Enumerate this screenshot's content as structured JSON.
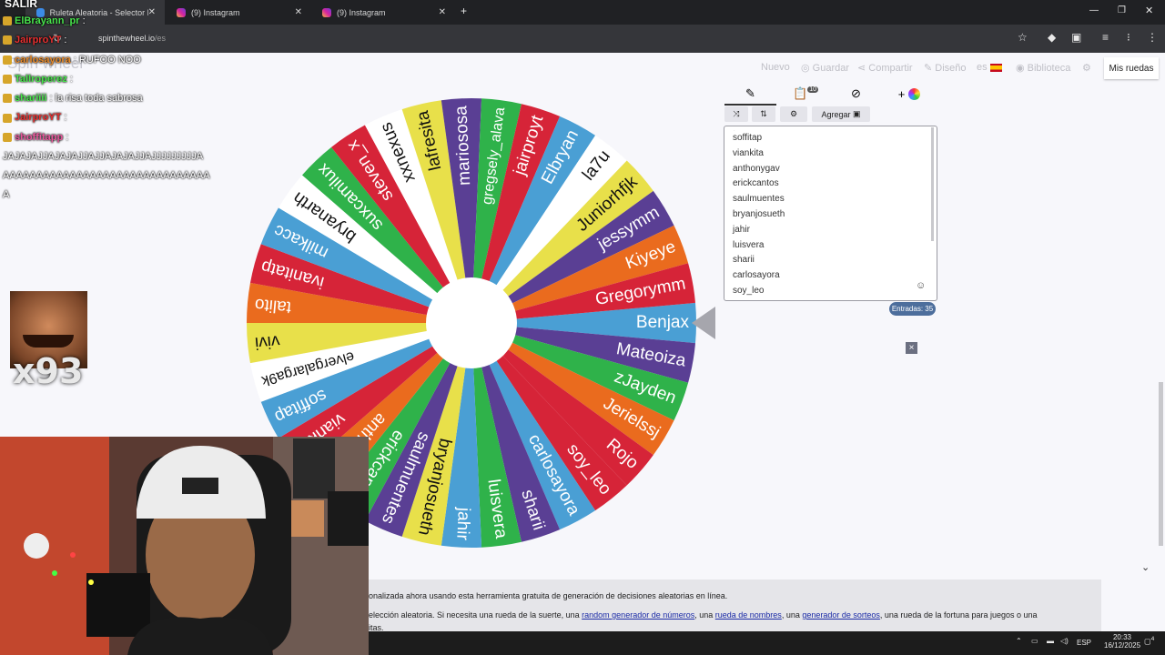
{
  "browser": {
    "tabs": [
      {
        "title": "Ruleta Aleatoria - Selector Pers",
        "active": true
      },
      {
        "title": "(9) Instagram",
        "active": false
      },
      {
        "title": "(9) Instagram",
        "active": false
      }
    ],
    "url_domain": "spinthewheel.io",
    "url_path": "/es",
    "new_tab": "+"
  },
  "stream": {
    "exit_label": "SALIR",
    "brand_faded": "Spin wheel",
    "counter": "x93",
    "chat": [
      {
        "user": "ElBrayann_pr",
        "message": ":",
        "color": "#48e44c"
      },
      {
        "user": "JairproYT",
        "message": ":",
        "color": "#e83030"
      },
      {
        "user": "carlosayora",
        "message": ": RUFOO NOO",
        "color": "#e88a2a"
      },
      {
        "user": "Tallroperez",
        "message": ":",
        "color": "#48e44c"
      },
      {
        "user": "shariiii",
        "message": ": la risa toda sabrosa",
        "color": "#48e44c"
      },
      {
        "user": "JairproYT",
        "message": ":",
        "color": "#e83030"
      },
      {
        "user": "shoffitapp",
        "message": ":",
        "color": "#e8579b"
      }
    ],
    "long_message": [
      "JAJAJAJJAJAJAJJAJJAJAJAJJAJJJJJJJJJA",
      "AAAAAAAAAAAAAAAAAAAAAAAAAAAAAAA",
      "A"
    ]
  },
  "menu": {
    "nuevo": "Nuevo",
    "guardar": "Guardar",
    "compartir": "Compartir",
    "diseno": "Diseño",
    "lang": "es",
    "biblioteca": "Biblioteca",
    "mis_ruedas": "Mis ruedas"
  },
  "panel": {
    "notif_count": "10",
    "add_label": "Agregar",
    "entries_badge": "Entradas: 35",
    "close": "×",
    "entries_visible": [
      "soffitap",
      "viankita",
      "anthonygav",
      "erickcantos",
      "saulmuentes",
      "bryanjosueth",
      "jahir",
      "luisvera",
      "sharii",
      "carlosayora",
      "soy_leo"
    ]
  },
  "wheel": {
    "segments": [
      {
        "label": "Benjax",
        "color": "#4a9fd4"
      },
      {
        "label": "Mateoiza",
        "color": "#5a3f94"
      },
      {
        "label": "zJayden",
        "color": "#2fb24a"
      },
      {
        "label": "Jerielssj",
        "color": "#ea6b1e"
      },
      {
        "label": "Rojo",
        "color": "#d62438"
      },
      {
        "label": "soy_leo",
        "color": "#d62438"
      },
      {
        "label": "carlosayora",
        "color": "#4a9fd4"
      },
      {
        "label": "sharii",
        "color": "#5a3f94"
      },
      {
        "label": "luisvera",
        "color": "#2fb24a"
      },
      {
        "label": "jahir",
        "color": "#4a9fd4"
      },
      {
        "label": "bryanjosueth",
        "color": "#e8e04a"
      },
      {
        "label": "saulmuentes",
        "color": "#5a3f94"
      },
      {
        "label": "erickcantos",
        "color": "#2fb24a"
      },
      {
        "label": "anthonygav",
        "color": "#ea6b1e"
      },
      {
        "label": "viankita",
        "color": "#d62438"
      },
      {
        "label": "soffitap",
        "color": "#4a9fd4"
      },
      {
        "label": "elvergalarga9k",
        "color": "#ffffff"
      },
      {
        "label": "vivi",
        "color": "#e8e04a"
      },
      {
        "label": "talito",
        "color": "#ea6b1e"
      },
      {
        "label": "ivanitatp",
        "color": "#d62438"
      },
      {
        "label": "milkacc",
        "color": "#4a9fd4"
      },
      {
        "label": "bryanarth",
        "color": "#ffffff"
      },
      {
        "label": "suxcamilux",
        "color": "#2fb24a"
      },
      {
        "label": "steven_x",
        "color": "#d62438"
      },
      {
        "label": "xxnexus",
        "color": "#ffffff"
      },
      {
        "label": "lafresita",
        "color": "#e8e04a"
      },
      {
        "label": "mariososa",
        "color": "#5a3f94"
      },
      {
        "label": "gregsely_alava",
        "color": "#2fb24a"
      },
      {
        "label": "jairproyt",
        "color": "#d62438"
      },
      {
        "label": "Elbryan",
        "color": "#4a9fd4"
      },
      {
        "label": "la7u",
        "color": "#ffffff"
      },
      {
        "label": "Juniorhfjk",
        "color": "#e8e04a"
      },
      {
        "label": "jessymm",
        "color": "#5a3f94"
      },
      {
        "label": "Kiyeye",
        "color": "#ea6b1e"
      },
      {
        "label": "Gregorymm",
        "color": "#d62438"
      }
    ]
  },
  "footer": {
    "line1": "onalizada ahora usando esta herramienta gratuita de generación de decisiones aleatorias en línea.",
    "line2_a": "elección aleatoria. Si necesita una rueda de la suerte, una ",
    "link1": "random generador de números",
    "line2_b": ", una ",
    "link2": "rueda de nombres",
    "line2_c": ", una ",
    "link3": "generador de sorteos",
    "line2_d": ", una rueda de la fortuna para juegos o una",
    "line3": "itas."
  },
  "taskbar": {
    "lang": "ESP",
    "time": "20:33",
    "date": "16/12/2025",
    "notif": "4"
  },
  "colors": {
    "chrome_dark": "#202124",
    "accent_badge": "#4d6e9c",
    "pointer": "#a6a6ad"
  }
}
